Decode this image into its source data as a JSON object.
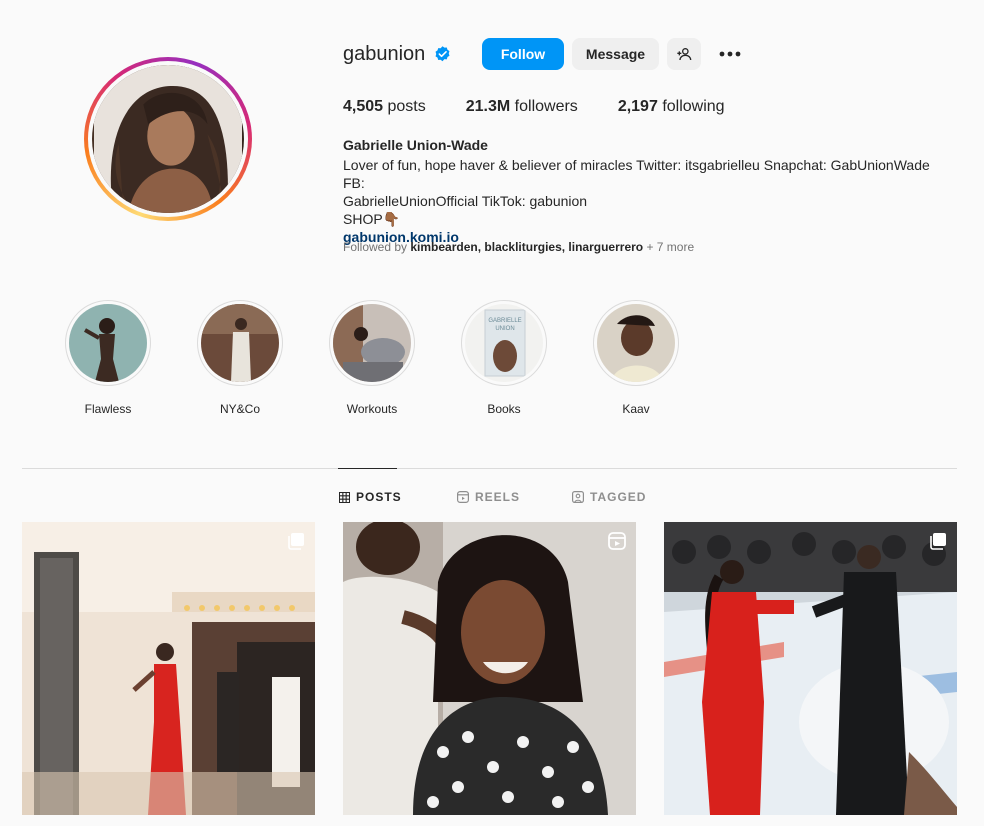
{
  "profile": {
    "username": "gabunion",
    "full_name": "Gabrielle Union-Wade",
    "bio_lines": [
      "Lover of fun, hope haver & believer of miracles Twitter: itsgabrielleu Snapchat: GabUnionWade FB:",
      "GabrielleUnionOfficial TikTok: gabunion",
      "SHOP👇🏾"
    ],
    "link": "gabunion.komi.io",
    "followed_by_prefix": "Followed by",
    "followed_by_names": "kimbearden, blackliturgies, linarguerrero",
    "followed_by_more": " + 7 more"
  },
  "actions": {
    "follow_label": "Follow",
    "message_label": "Message"
  },
  "stats": {
    "posts_count": "4,505",
    "posts_label": "posts",
    "followers_count": "21.3M",
    "followers_label": "followers",
    "following_count": "2,197",
    "following_label": "following"
  },
  "highlights": [
    {
      "label": "Flawless"
    },
    {
      "label": "NY&Co"
    },
    {
      "label": "Workouts"
    },
    {
      "label": "Books"
    },
    {
      "label": "Kaav"
    }
  ],
  "tabs": {
    "posts": "POSTS",
    "reels": "REELS",
    "tagged": "TAGGED"
  },
  "colors": {
    "accent": "#0095f6",
    "verified": "#0095f6",
    "link": "#00376b"
  }
}
